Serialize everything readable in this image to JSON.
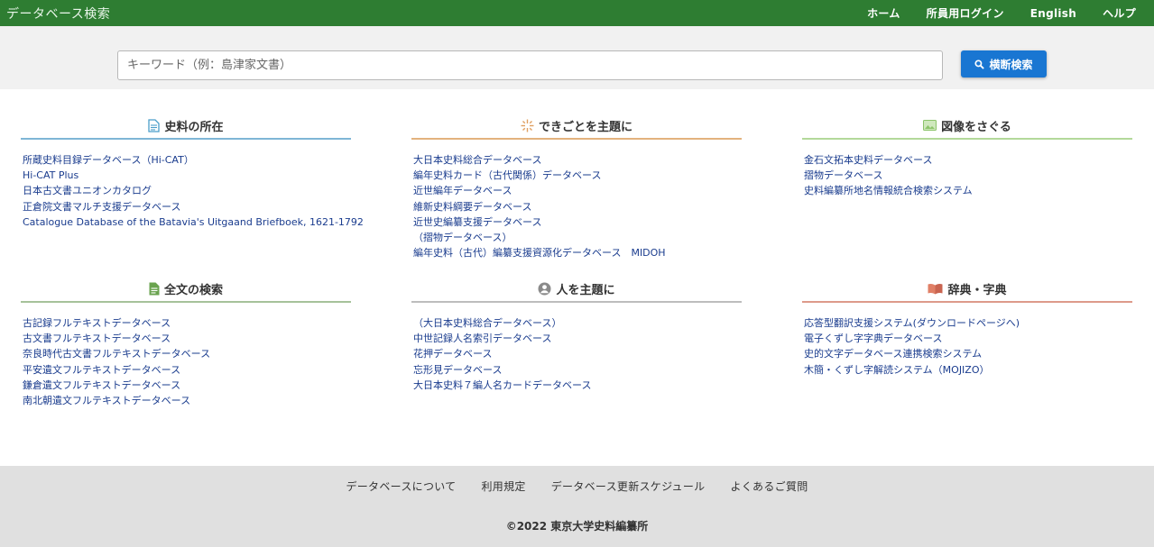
{
  "header": {
    "brand": "データベース検索",
    "nav": [
      "ホーム",
      "所員用ログイン",
      "English",
      "ヘルプ"
    ]
  },
  "search": {
    "placeholder": "キーワード（例：島津家文書）",
    "button_label": "横断検索"
  },
  "colors": {
    "header_bg": "#2e7d32",
    "button_bg": "#1976d2",
    "link": "#1a3c8e"
  },
  "sections": [
    {
      "title": "史料の所在",
      "icon": "document-icon",
      "rule_color": "#7fb6d6",
      "links": [
        "所蔵史料目録データベース（Hi-CAT）",
        "Hi-CAT Plus",
        "日本古文書ユニオンカタログ",
        "正倉院文書マルチ支援データベース",
        "Catalogue Database of the Batavia's Uitgaand Briefboek, 1621-1792"
      ]
    },
    {
      "title": "できごとを主題に",
      "icon": "sparkle-icon",
      "rule_color": "#e3b27e",
      "links": [
        "大日本史料総合データベース",
        "編年史料カード（古代関係）データベース",
        "近世編年データベース",
        "維新史料綱要データベース",
        "近世史編纂支援データベース",
        "（摺物データベース）",
        "編年史料（古代）編纂支援資源化データベース　MIDOH"
      ]
    },
    {
      "title": "図像をさぐる",
      "icon": "image-icon",
      "rule_color": "#b3d99a",
      "links": [
        "金石文拓本史料データベース",
        "摺物データベース",
        "史料編纂所地名情報統合検索システム"
      ]
    },
    {
      "title": "全文の検索",
      "icon": "text-file-icon",
      "rule_color": "#a6c29a",
      "links": [
        "古記録フルテキストデータベース",
        "古文書フルテキストデータベース",
        "奈良時代古文書フルテキストデータベース",
        "平安遺文フルテキストデータベース",
        "鎌倉遺文フルテキストデータベース",
        "南北朝遺文フルテキストデータベース"
      ]
    },
    {
      "title": "人を主題に",
      "icon": "person-icon",
      "rule_color": "#bdbdbd",
      "links": [
        "（大日本史料総合データベース）",
        "中世記録人名索引データベース",
        "花押データベース",
        "忘形見データベース",
        "大日本史料７編人名カードデータベース"
      ]
    },
    {
      "title": "辞典・字典",
      "icon": "book-icon",
      "rule_color": "#dd9a8a",
      "links": [
        "応答型翻訳支援システム(ダウンロードページへ)",
        "電子くずし字字典データベース",
        "史的文字データベース連携検索システム",
        "木簡・くずし字解読システム（MOJIZO）"
      ]
    }
  ],
  "footer": {
    "links": [
      "データベースについて",
      "利用規定",
      "データベース更新スケジュール",
      "よくあるご質問"
    ],
    "copyright": "©2022 東京大学史料編纂所"
  }
}
